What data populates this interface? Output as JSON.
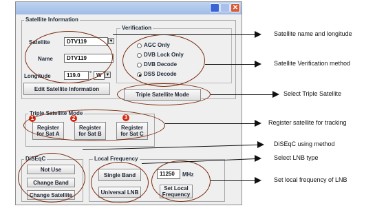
{
  "window": {
    "title_buttons": {
      "minimize": "minimize",
      "maximize": "maximize",
      "close": "✕"
    }
  },
  "satellite_information": {
    "group_title": "Satellite Information",
    "satellite_label": "Satellite",
    "satellite_value": "DTV119",
    "name_label": "Name",
    "name_value": "DTV119",
    "longitude_label": "Longitude",
    "longitude_value": "119.0",
    "degree_symbol": "°",
    "direction_value": "W",
    "edit_button": "Edit Satellite Information"
  },
  "verification": {
    "group_title": "Verification",
    "options": [
      "AGC Only",
      "DVB Lock Only",
      "DVB Decode",
      "DSS Decode"
    ],
    "selected_index": 3,
    "triple_button": "Triple Satellite Mode"
  },
  "triple_satellite_mode": {
    "group_title": "Triple Satellite Mode",
    "buttons": [
      {
        "number": "1",
        "line1": "Register",
        "line2": "for Sat A"
      },
      {
        "number": "2",
        "line1": "Register",
        "line2": "for Sat B"
      },
      {
        "number": "3",
        "line1": "Register",
        "line2": "for Sat C"
      }
    ]
  },
  "diseqc": {
    "group_title": "DiSEqC",
    "buttons": [
      "Not Use",
      "Change Band",
      "Change Satellite"
    ]
  },
  "local_frequency": {
    "group_title": "Local Frequency",
    "single_band": "Single Band",
    "universal_lnb": "Universal LNB",
    "frequency_value": "11250",
    "unit": "MHz",
    "set_line1": "Set Local",
    "set_line2": "Frequency"
  },
  "annotations": [
    "Satellite name and longitude",
    "Satellite Verification method",
    "Select Triple Satellite",
    "Register satellite for tracking",
    "DiSEqC using method",
    "Select LNB type",
    "Set local frequency of LNB"
  ],
  "colors": {
    "annotation_ellipse": "#7a2a0a",
    "badge": "#d42a12",
    "titlebar": "#9fbbe7"
  }
}
